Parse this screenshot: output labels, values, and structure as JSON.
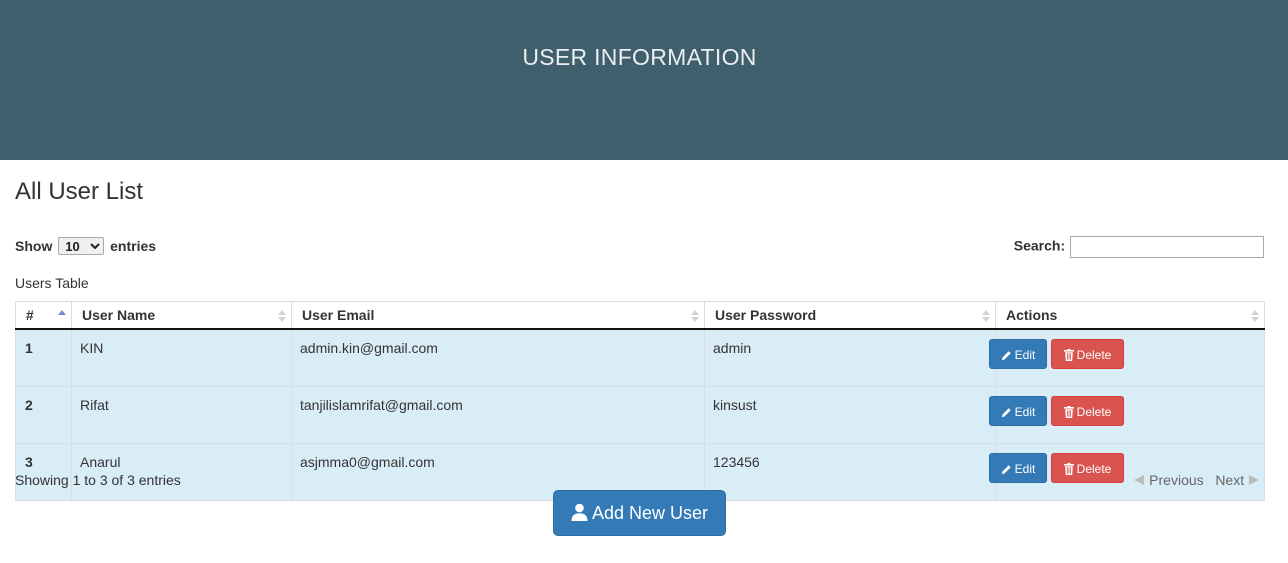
{
  "header": {
    "title": "USER INFORMATION"
  },
  "page": {
    "title": "All User List"
  },
  "length": {
    "prefix": "Show",
    "value": "10",
    "suffix": "entries"
  },
  "search": {
    "label": "Search:",
    "value": "",
    "placeholder": ""
  },
  "table": {
    "caption": "Users Table",
    "columns": [
      "#",
      "User Name",
      "User Email",
      "User Password",
      "Actions"
    ],
    "rows": [
      {
        "id": "1",
        "name": "KIN",
        "email": "admin.kin@gmail.com",
        "password": "admin"
      },
      {
        "id": "2",
        "name": "Rifat",
        "email": "tanjilislamrifat@gmail.com",
        "password": "kinsust"
      },
      {
        "id": "3",
        "name": "Anarul",
        "email": "asjmma0@gmail.com",
        "password": "123456"
      }
    ],
    "edit_label": "Edit",
    "delete_label": "Delete"
  },
  "info": "Showing 1 to 3 of 3 entries",
  "pagination": {
    "previous": "Previous",
    "next": "Next"
  },
  "add_button": {
    "label": "Add New User"
  },
  "colors": {
    "header_bg": "#3e5f6b",
    "row_bg": "#d9edf7",
    "primary": "#337ab7",
    "danger": "#d9534f"
  },
  "icons": {
    "edit": "pencil-icon",
    "delete": "trash-icon",
    "add": "user-icon",
    "previous": "triangle-left-icon",
    "next": "triangle-right-icon",
    "sort": "sort-arrows-icon"
  }
}
